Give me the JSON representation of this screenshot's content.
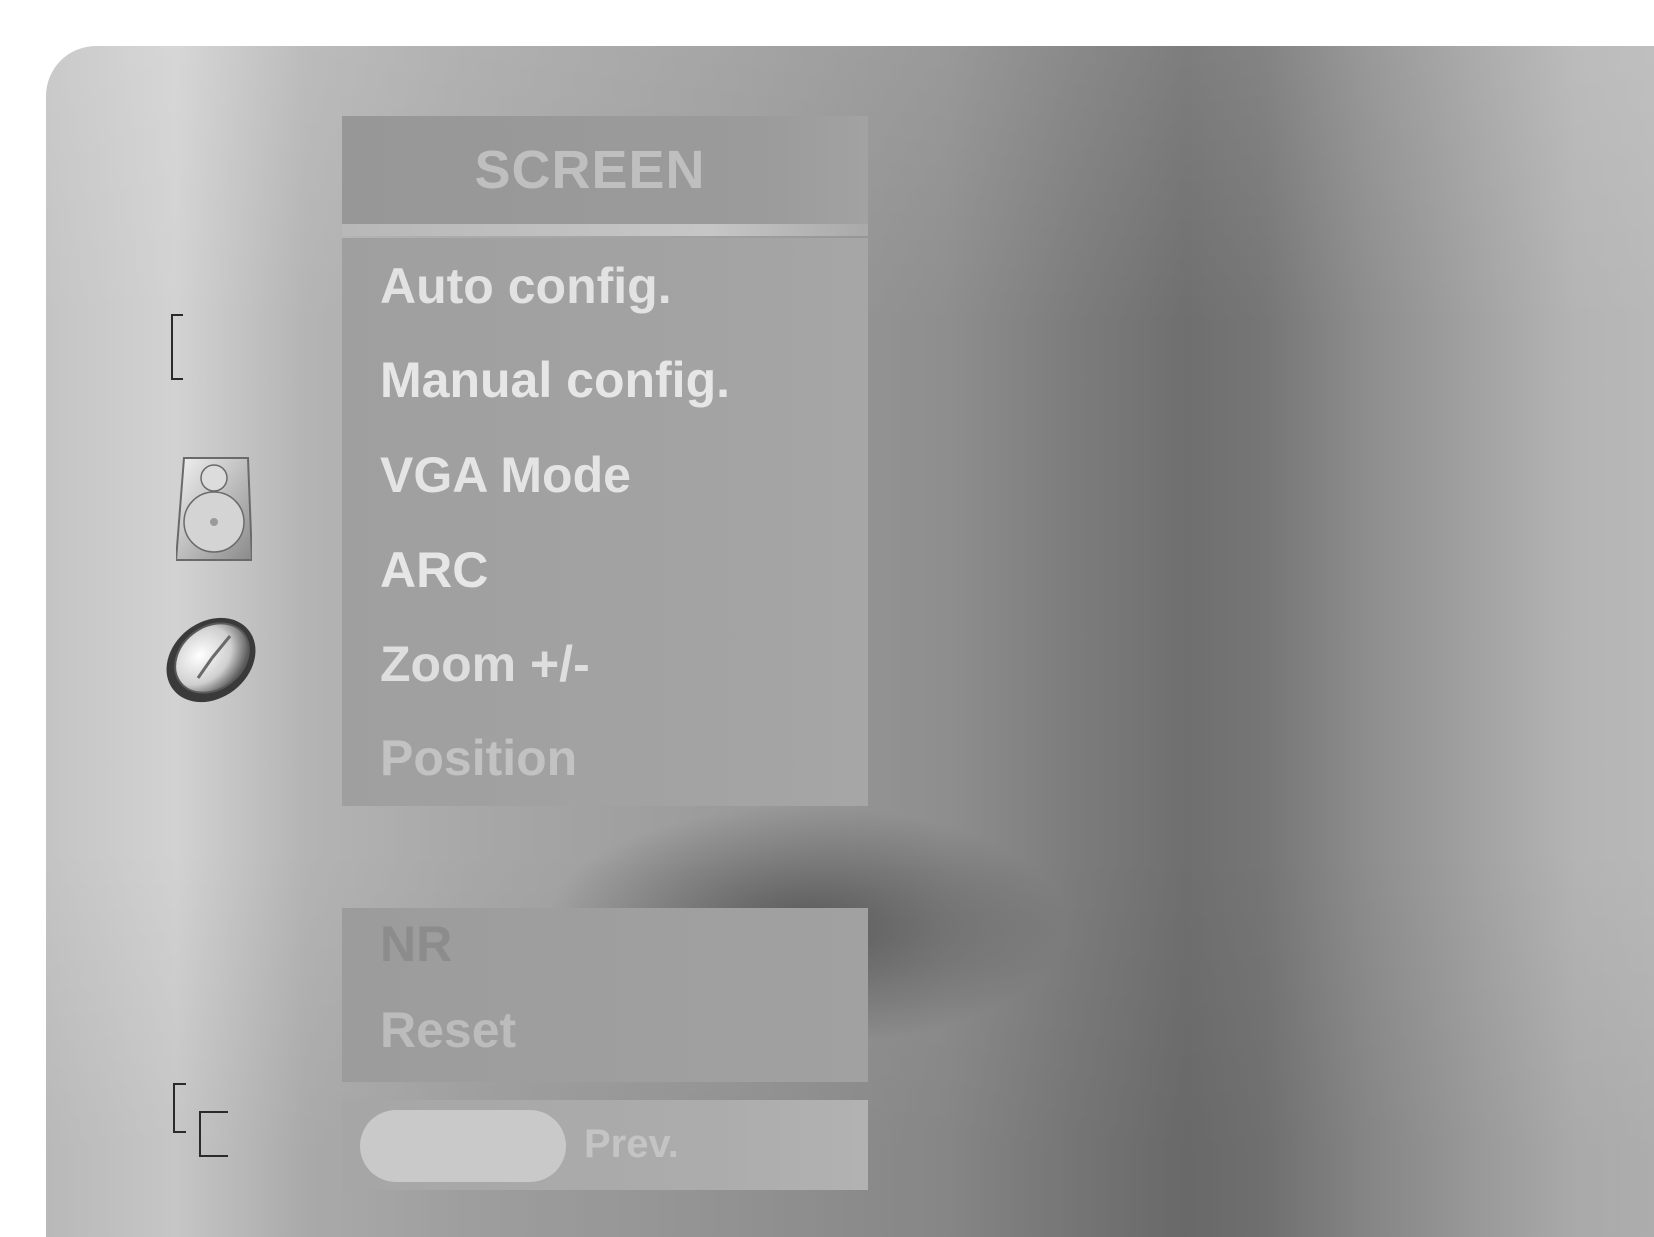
{
  "menu": {
    "title": "SCREEN",
    "items": [
      {
        "label": "Auto config."
      },
      {
        "label": "Manual config."
      },
      {
        "label": "VGA Mode"
      },
      {
        "label": "ARC"
      },
      {
        "label": "Zoom +/-"
      },
      {
        "label": "Position"
      }
    ],
    "lower_items": [
      {
        "label": "NR"
      },
      {
        "label": "Reset"
      }
    ]
  },
  "footer": {
    "prev_label": "Prev."
  },
  "icons": {
    "side_icons": [
      "bracket-icon",
      "speaker-icon",
      "clock-icon",
      "window-icon"
    ]
  },
  "colors": {
    "menu_background": "#a0a0a0",
    "text_highlight": "#e4e4e4",
    "text_dim": "#c9c9c9"
  }
}
